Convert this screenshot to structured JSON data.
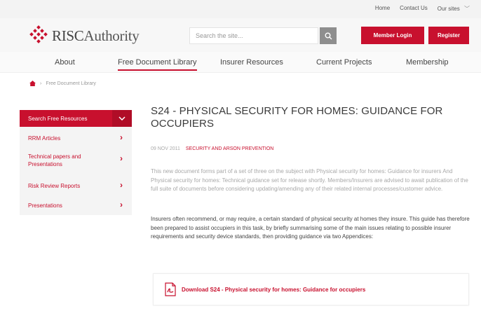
{
  "topbar": {
    "home": "Home",
    "contact": "Contact Us",
    "oursites": "Our sites"
  },
  "header": {
    "logo_prefix": "RISC",
    "logo_suffix": "Authority",
    "search_placeholder": "Search the site...",
    "member_login": "Member Login",
    "register": "Register"
  },
  "nav": {
    "items": [
      "About",
      "Free Document Library",
      "Insurer Resources",
      "Current Projects",
      "Membership"
    ]
  },
  "breadcrumb": {
    "current": "Free Document Library"
  },
  "sidebar": {
    "header": "Search Free Resources",
    "items": [
      "RRM Articles",
      "Technical papers and Presentations",
      "Risk Review Reports",
      "Presentations"
    ]
  },
  "article": {
    "title": "S24 - PHYSICAL SECURITY FOR HOMES: GUIDANCE FOR OCCUPIERS",
    "date": "09 NOV 2011",
    "category": "SECURITY AND ARSON PREVENTION",
    "intro": "This new document forms part of a set of three on the subject with Physical security for homes: Guidance for insurers And Physical security for homes: Technical guidance set for release shortly. Members/Insurers are advised to await publication of the full suite of documents before considering updating/amending any of their related internal processes/customer advice.",
    "body": "Insurers often recommend, or may require, a certain standard of physical security at homes they insure. This guide has therefore been prepared to assist occupiers in this task, by briefly summarising some of the main issues relating to possible insurer requirements and security device standards, then providing guidance via two Appendices:",
    "download": "Download S24 - Physical security for homes: Guidance for occupiers"
  },
  "colors": {
    "brand_red": "#c8102e",
    "search_button": "#8e8e8e"
  },
  "icons": [
    "logo-diamond-icon",
    "search-icon",
    "home-icon",
    "chevron-down-icon",
    "chevron-right-icon",
    "pdf-icon"
  ]
}
